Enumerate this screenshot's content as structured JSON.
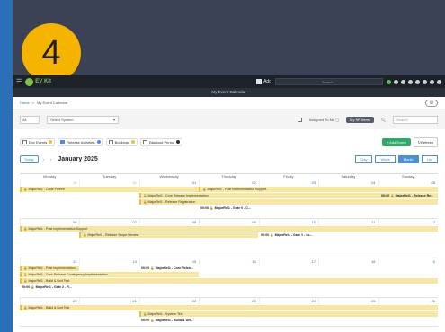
{
  "step_number": "4",
  "colors": {
    "accent": "#f5b400",
    "event_bar": "#f8e6a3",
    "brand_green": "#7cc04b"
  },
  "topbar": {
    "logo_text": "EV Kit",
    "add_label": "Add",
    "search_placeholder": "Search..."
  },
  "subtitle": "My Event Calendar",
  "breadcrumb": {
    "home": "Home",
    "sep": ">",
    "current": "My Event Calendar"
  },
  "filters": {
    "small_select": "All",
    "system_select_placeholder": "Select System",
    "assigned_label": "Assigned To Me ▢",
    "my_sr_button": "My SR Items",
    "search_placeholder": "Search"
  },
  "legend": [
    {
      "label": "Env Events",
      "color": "#e8c23c"
    },
    {
      "label": "Release Activities",
      "color": "#4a8fd8"
    },
    {
      "label": "Bookings",
      "color": "#e8c23c"
    },
    {
      "label": "Blackout Period",
      "color": "#333333"
    }
  ],
  "actions": {
    "add_event": "+ Add Event",
    "refresh": "↻Refresh"
  },
  "calendar": {
    "today": "Today",
    "prev": "‹",
    "next": "›",
    "month_title": "January 2025",
    "views": [
      "Day",
      "Week",
      "Month",
      "List"
    ],
    "active_view": "Month",
    "days_of_week": [
      "Monday",
      "Tuesday",
      "Wednesday",
      "Thursday",
      "Friday",
      "Saturday",
      "Sunday"
    ],
    "weeks": [
      {
        "days": [
          "30",
          "31",
          "01",
          "02",
          "03",
          "04",
          "05"
        ],
        "events": [
          {
            "text": "🔒 MajorRel1 - Code Freeze"
          },
          {
            "text": "🔒 MajorRel1 - Post Implementation Support"
          },
          {
            "text": "🔒 MajorRel1 - Core Release Implementation"
          },
          {
            "text": "🔒 MajorRel1 - Release Registration"
          },
          {
            "text": "00:00 🔒 MajorRel1 - Release Re..."
          },
          {
            "text": "00:00 🔒 MajorRel1 - Gate 0 - C..."
          }
        ]
      },
      {
        "days": [
          "06",
          "07",
          "08",
          "09",
          "10",
          "11",
          "12"
        ],
        "events": [
          {
            "text": "🔒 MajorRel1 - Post Implementation Support"
          },
          {
            "text": "🔒 MajorRel1 - Release Scope Review"
          },
          {
            "text": "00:00 🔒 MajorRel1 - Gate 1 - Sc..."
          }
        ]
      },
      {
        "days": [
          "13",
          "14",
          "15",
          "16",
          "17",
          "18",
          "19"
        ],
        "events": [
          {
            "text": "🔒 MajorRel1 - Post Implementation..."
          },
          {
            "text": "00:00 🔒 MajorRel1 - Core Relea..."
          },
          {
            "text": "🔒 MajorRel1 - Core Release Contingency Implementation"
          },
          {
            "text": "🔒 MajorRel1 - Build & Unit Test"
          },
          {
            "text": "00:00 🔒 MajorRel1 - Gate 2 - R..."
          }
        ]
      },
      {
        "days": [
          "20",
          "21",
          "22",
          "23",
          "24",
          "25",
          "26"
        ],
        "events": [
          {
            "text": "🔒 MajorRel1 - Build & Unit Test"
          },
          {
            "text": "🔒 MajorRel1 - System Test"
          },
          {
            "text": "00:00 🔒 MajorRel1 - Build & Uni..."
          }
        ]
      }
    ]
  }
}
